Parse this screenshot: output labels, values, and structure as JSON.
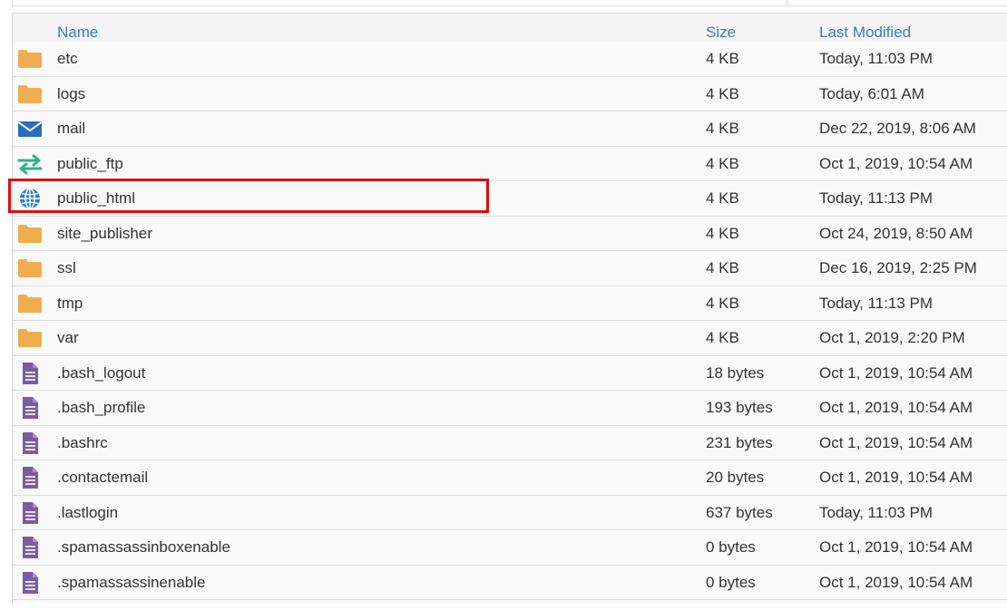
{
  "table": {
    "headers": {
      "name": "Name",
      "size": "Size",
      "modified": "Last Modified"
    },
    "rows": [
      {
        "icon": "folder-icon",
        "name": "etc",
        "size": "4 KB",
        "modified": "Today, 11:03 PM"
      },
      {
        "icon": "folder-icon",
        "name": "logs",
        "size": "4 KB",
        "modified": "Today, 6:01 AM"
      },
      {
        "icon": "mail-icon",
        "name": "mail",
        "size": "4 KB",
        "modified": "Dec 22, 2019, 8:06 AM"
      },
      {
        "icon": "transfer-arrows-icon",
        "name": "public_ftp",
        "size": "4 KB",
        "modified": "Oct 1, 2019, 10:54 AM"
      },
      {
        "icon": "globe-icon",
        "name": "public_html",
        "size": "4 KB",
        "modified": "Today, 11:13 PM"
      },
      {
        "icon": "folder-icon",
        "name": "site_publisher",
        "size": "4 KB",
        "modified": "Oct 24, 2019, 8:50 AM"
      },
      {
        "icon": "folder-icon",
        "name": "ssl",
        "size": "4 KB",
        "modified": "Dec 16, 2019, 2:25 PM"
      },
      {
        "icon": "folder-icon",
        "name": "tmp",
        "size": "4 KB",
        "modified": "Today, 11:13 PM"
      },
      {
        "icon": "folder-icon",
        "name": "var",
        "size": "4 KB",
        "modified": "Oct 1, 2019, 2:20 PM"
      },
      {
        "icon": "file-text-icon",
        "name": ".bash_logout",
        "size": "18 bytes",
        "modified": "Oct 1, 2019, 10:54 AM"
      },
      {
        "icon": "file-text-icon",
        "name": ".bash_profile",
        "size": "193 bytes",
        "modified": "Oct 1, 2019, 10:54 AM"
      },
      {
        "icon": "file-text-icon",
        "name": ".bashrc",
        "size": "231 bytes",
        "modified": "Oct 1, 2019, 10:54 AM"
      },
      {
        "icon": "file-text-icon",
        "name": ".contactemail",
        "size": "20 bytes",
        "modified": "Oct 1, 2019, 10:54 AM"
      },
      {
        "icon": "file-text-icon",
        "name": ".lastlogin",
        "size": "637 bytes",
        "modified": "Today, 11:03 PM"
      },
      {
        "icon": "file-text-icon",
        "name": ".spamassassinboxenable",
        "size": "0 bytes",
        "modified": "Oct 1, 2019, 10:54 AM"
      },
      {
        "icon": "file-text-icon",
        "name": ".spamassassinenable",
        "size": "0 bytes",
        "modified": "Oct 1, 2019, 10:54 AM"
      },
      {
        "icon": "folder-icon",
        "name": "",
        "size": "",
        "modified": ""
      }
    ]
  },
  "highlight": {
    "row_name": "public_html",
    "color": "#e10a0a"
  },
  "colors": {
    "header_link": "#3a7cc4",
    "folder": "#f0ad4e",
    "mail": "#2a6ebb",
    "transfer": "#2bb38a",
    "globe": "#2a7fd4",
    "file": "#7b5c9e"
  }
}
